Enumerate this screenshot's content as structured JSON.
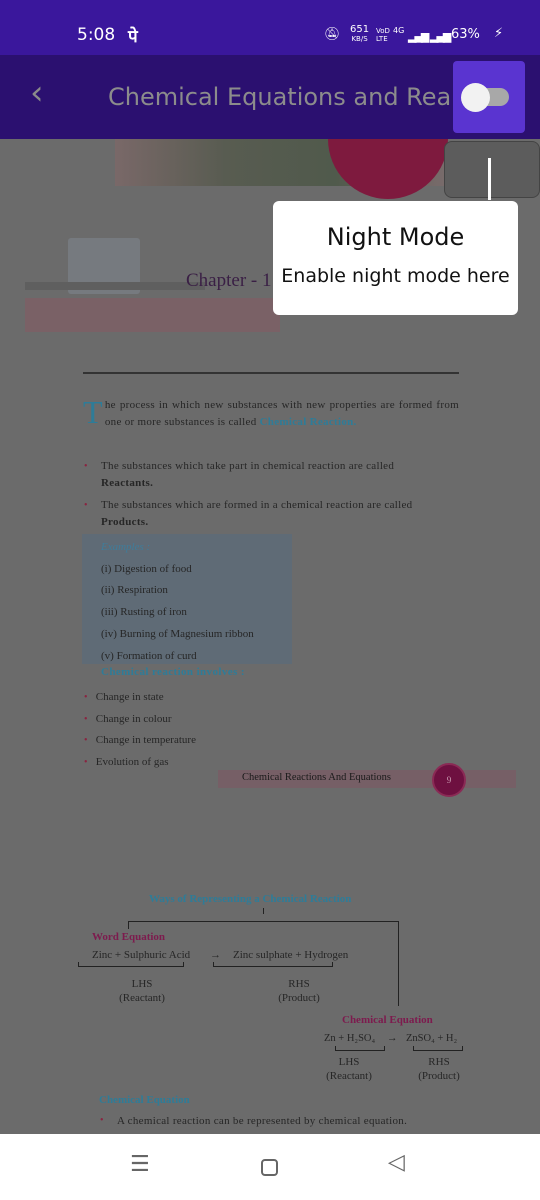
{
  "status_bar": {
    "time": "5:08",
    "carrier_glyph": "पे",
    "speed": "651",
    "speed_unit": "KB/S",
    "volte": "VoD LTE",
    "network": "4G",
    "battery": "63%"
  },
  "app_bar": {
    "title": "Chemical Equations and Rea...",
    "night_mode_toggle": {
      "on": false
    }
  },
  "tooltip": {
    "title": "Night Mode",
    "text": "Enable night mode here"
  },
  "page": {
    "chapter": "Chapter - 1",
    "intro_dropcap": "T",
    "intro": "he process in which new substances with new properties are formed from one or more substances is called",
    "intro_term": "Chemical Reaction.",
    "bullets": [
      {
        "text": "The substances which take part in chemical reaction are called",
        "term": "Reactants."
      },
      {
        "text": "The substances which are formed in a chemical reaction are called",
        "term": "Products."
      }
    ],
    "examples_title": "Examples :",
    "examples": [
      "(i)  Digestion of food",
      "(ii)  Respiration",
      "(iii) Rusting of iron",
      "(iv)  Burning of Magnesium ribbon",
      "(v)  Formation of curd"
    ],
    "involves_title": "Chemical reaction involves :",
    "involves": [
      "Change in state",
      "Change in colour",
      "Change in temperature",
      "Evolution of gas"
    ],
    "footer_title": "Chemical Reactions And Equations",
    "page_number": "9"
  },
  "page2": {
    "ways_title": "Ways of Representing a Chemical Reaction",
    "word_eq_title": "Word Equation",
    "word_lhs": "Zinc + Sulphuric Acid",
    "arrow": "→",
    "word_rhs": "Zinc sulphate + Hydrogen",
    "lhs": "LHS",
    "reactant": "(Reactant)",
    "rhs": "RHS",
    "product": "(Product)",
    "chem_eq_title": "Chemical Equation",
    "chem_lhs": "Zn + H₂SO₄",
    "chem_rhs": "ZnSO₄ + H₂",
    "section_title": "Chemical Equation",
    "section_text": "A chemical reaction can be represented by chemical equation."
  },
  "colors": {
    "status_bar": "#3a179c",
    "app_bar": "#2b1070",
    "toggle_bg": "#5a34d0",
    "teal": "#2e7c98",
    "magenta": "#7d1b4e"
  }
}
